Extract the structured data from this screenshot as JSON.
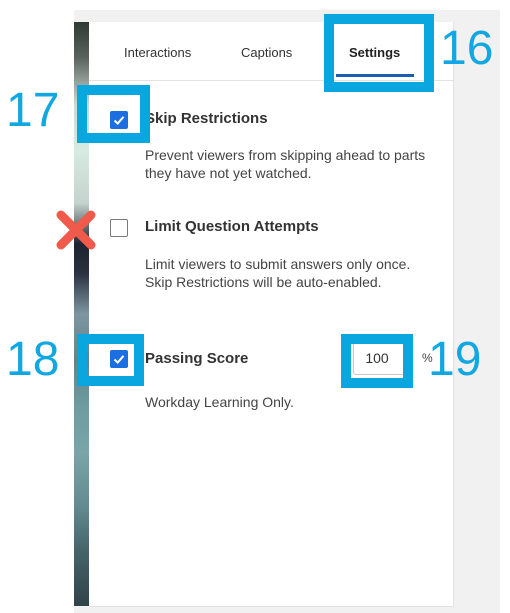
{
  "tabs": [
    {
      "label": "Interactions"
    },
    {
      "label": "Captions"
    },
    {
      "label": "Settings",
      "active": true
    }
  ],
  "settings": {
    "skip_restrictions": {
      "title": "Skip Restrictions",
      "checked": true,
      "description": "Prevent viewers from skipping ahead to parts they have not yet watched."
    },
    "limit_attempts": {
      "title": "Limit Question Attempts",
      "checked": false,
      "description": "Limit viewers to submit answers only once. Skip Restrictions will be auto-enabled."
    },
    "passing_score": {
      "title": "Passing Score",
      "checked": true,
      "value": "100",
      "unit": "%",
      "description": "Workday Learning Only."
    }
  },
  "callouts": {
    "settings_tab": "16",
    "skip_checkbox": "17",
    "passing_checkbox": "18",
    "score_field": "19"
  },
  "colors": {
    "highlight": "#0aa6e0",
    "callout_text": "#12a7e1",
    "checkbox": "#1c6fe0",
    "tab_underline": "#1b5fb4",
    "x_mark": "#ef5a4a"
  },
  "icons": {
    "check": "checkmark-icon",
    "x": "red-x-icon"
  }
}
